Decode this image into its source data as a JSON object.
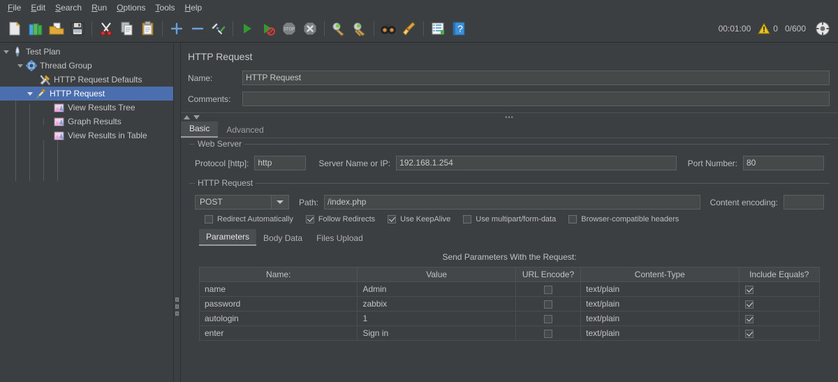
{
  "menubar": {
    "items": [
      {
        "label": "File",
        "mnemonic": "F"
      },
      {
        "label": "Edit",
        "mnemonic": "E"
      },
      {
        "label": "Search",
        "mnemonic": "S"
      },
      {
        "label": "Run",
        "mnemonic": "R"
      },
      {
        "label": "Options",
        "mnemonic": "O"
      },
      {
        "label": "Tools",
        "mnemonic": "T"
      },
      {
        "label": "Help",
        "mnemonic": "H"
      }
    ]
  },
  "toolbar": {
    "buttons": [
      {
        "name": "new-icon",
        "tooltip": "New"
      },
      {
        "name": "templates-icon",
        "tooltip": "Templates"
      },
      {
        "name": "open-icon",
        "tooltip": "Open"
      },
      {
        "name": "save-icon",
        "tooltip": "Save Test Plan"
      },
      {
        "name": "cut-icon",
        "tooltip": "Cut"
      },
      {
        "name": "copy-icon",
        "tooltip": "Copy"
      },
      {
        "name": "paste-icon",
        "tooltip": "Paste"
      },
      {
        "name": "expand-all-icon",
        "tooltip": "Expand All"
      },
      {
        "name": "collapse-all-icon",
        "tooltip": "Collapse All"
      },
      {
        "name": "toggle-icon",
        "tooltip": "Toggle"
      },
      {
        "name": "start-icon",
        "tooltip": "Start"
      },
      {
        "name": "start-no-pauses-icon",
        "tooltip": "Start no pauses"
      },
      {
        "name": "stop-icon",
        "tooltip": "Stop"
      },
      {
        "name": "shutdown-icon",
        "tooltip": "Shutdown"
      },
      {
        "name": "clear-icon",
        "tooltip": "Clear"
      },
      {
        "name": "clear-all-icon",
        "tooltip": "Clear All"
      },
      {
        "name": "search-icon",
        "tooltip": "Search"
      },
      {
        "name": "search-reset-icon",
        "tooltip": "Reset Search"
      },
      {
        "name": "function-helper-icon",
        "tooltip": "Function Helper Dialog"
      },
      {
        "name": "help-icon",
        "tooltip": "Help"
      }
    ],
    "status": {
      "elapsed_time": "00:01:00",
      "warning_icon": "warning-triangle-icon",
      "warning_count": "0",
      "threads": "0/600",
      "remote_icon": "remote-engines-icon"
    }
  },
  "tree": {
    "nodes": [
      {
        "label": "Test Plan",
        "depth": 0,
        "icon": "test-plan-icon",
        "expanded": true,
        "selected": false
      },
      {
        "label": "Thread Group",
        "depth": 1,
        "icon": "thread-group-icon",
        "expanded": true,
        "selected": false
      },
      {
        "label": "HTTP Request Defaults",
        "depth": 2,
        "icon": "http-defaults-icon",
        "expanded": false,
        "selected": false
      },
      {
        "label": "HTTP Request",
        "depth": 2,
        "icon": "http-request-icon",
        "expanded": true,
        "selected": true
      },
      {
        "label": "View Results Tree",
        "depth": 3,
        "icon": "listener-icon",
        "expanded": false,
        "selected": false
      },
      {
        "label": "Graph Results",
        "depth": 3,
        "icon": "listener-icon",
        "expanded": false,
        "selected": false
      },
      {
        "label": "View Results in Table",
        "depth": 3,
        "icon": "listener-icon",
        "expanded": false,
        "selected": false
      }
    ]
  },
  "panel": {
    "title": "HTTP Request",
    "name_label": "Name:",
    "name_value": "HTTP Request",
    "comments_label": "Comments:",
    "comments_value": "",
    "comments_placeholder": "",
    "tabs": [
      {
        "label": "Basic",
        "active": true
      },
      {
        "label": "Advanced",
        "active": false
      }
    ],
    "web_server": {
      "group_title": "Web Server",
      "protocol_label": "Protocol [http]:",
      "protocol_value": "http",
      "server_label": "Server Name or IP:",
      "server_value": "192.168.1.254",
      "port_label": "Port Number:",
      "port_value": "80"
    },
    "http_request": {
      "group_title": "HTTP Request",
      "method_value": "POST",
      "path_label": "Path:",
      "path_value": "/index.php",
      "encoding_label": "Content encoding:",
      "encoding_value": ""
    },
    "options": [
      {
        "label": "Redirect Automatically",
        "checked": false
      },
      {
        "label": "Follow Redirects",
        "checked": true
      },
      {
        "label": "Use KeepAlive",
        "checked": true
      },
      {
        "label": "Use multipart/form-data",
        "checked": false
      },
      {
        "label": "Browser-compatible headers",
        "checked": false
      }
    ],
    "param_tabs": [
      {
        "label": "Parameters",
        "active": true
      },
      {
        "label": "Body Data",
        "active": false
      },
      {
        "label": "Files Upload",
        "active": false
      }
    ],
    "table": {
      "caption": "Send Parameters With the Request:",
      "columns": [
        "Name:",
        "Value",
        "URL Encode?",
        "Content-Type",
        "Include Equals?"
      ],
      "rows": [
        {
          "name": "name",
          "value": "Admin",
          "url_encode": false,
          "content_type": "text/plain",
          "include_equals": true
        },
        {
          "name": "password",
          "value": "zabbix",
          "url_encode": false,
          "content_type": "text/plain",
          "include_equals": true
        },
        {
          "name": "autologin",
          "value": "1",
          "url_encode": false,
          "content_type": "text/plain",
          "include_equals": true
        },
        {
          "name": "enter",
          "value": "Sign in",
          "url_encode": false,
          "content_type": "text/plain",
          "include_equals": true
        }
      ]
    }
  },
  "colors": {
    "background": "#3c3f41",
    "selection": "#4b6eaf",
    "field_background": "#45494a",
    "border": "#5e6060",
    "text": "#bbbbbb",
    "accent_green": "#33a02c",
    "warning_yellow": "#e8c020"
  }
}
